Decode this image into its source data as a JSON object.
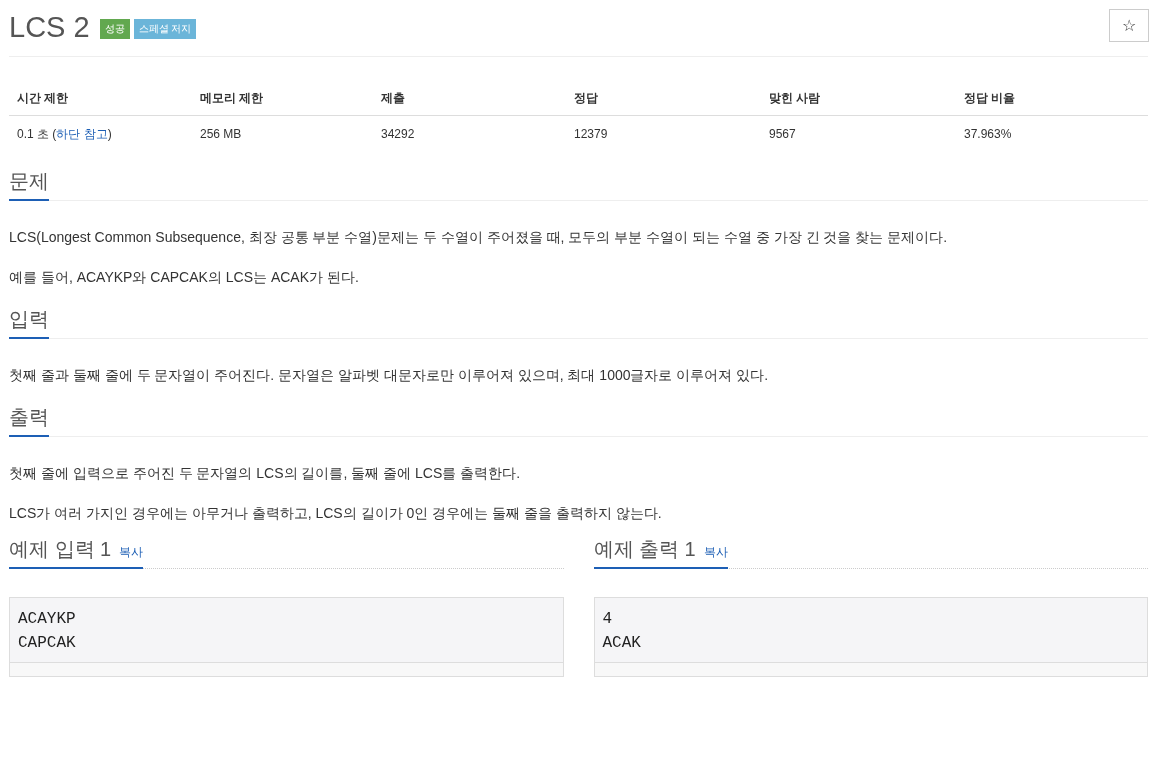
{
  "title": "LCS 2",
  "badges": [
    {
      "label": "성공",
      "color": "#62a84f"
    },
    {
      "label": "스페셜 저지",
      "color": "#6bb5d9"
    }
  ],
  "star_button": "☆",
  "info_table": {
    "columns": [
      "시간 제한",
      "메모리 제한",
      "제출",
      "정답",
      "맞힌 사람",
      "정답 비율"
    ],
    "time_limit": {
      "text": "0.1 초 (",
      "link": "하단 참고",
      "suffix": ")"
    },
    "cells": [
      "256 MB",
      "34292",
      "12379",
      "9567",
      "37.963%"
    ]
  },
  "sections": [
    {
      "heading": "문제",
      "paragraphs": [
        "LCS(Longest Common Subsequence, 최장 공통 부분 수열)문제는 두 수열이 주어졌을 때, 모두의 부분 수열이 되는 수열 중 가장 긴 것을 찾는 문제이다.",
        "예를 들어, ACAYKP와 CAPCAK의 LCS는 ACAK가 된다."
      ]
    },
    {
      "heading": "입력",
      "paragraphs": [
        "첫째 줄과 둘째 줄에 두 문자열이 주어진다. 문자열은 알파벳 대문자로만 이루어져 있으며, 최대 1000글자로 이루어져 있다."
      ]
    },
    {
      "heading": "출력",
      "paragraphs": [
        "첫째 줄에 입력으로 주어진 두 문자열의 LCS의 길이를, 둘째 줄에 LCS를 출력한다.",
        "LCS가 여러 가지인 경우에는 아무거나 출력하고, LCS의 길이가 0인 경우에는 둘째 줄을 출력하지 않는다."
      ]
    }
  ],
  "samples": [
    {
      "heading": "예제 입력 1",
      "copy": "복사",
      "lines": [
        "ACAYKP",
        "CAPCAK"
      ]
    },
    {
      "heading": "예제 출력 1",
      "copy": "복사",
      "lines": [
        "4",
        "ACAK"
      ]
    }
  ]
}
